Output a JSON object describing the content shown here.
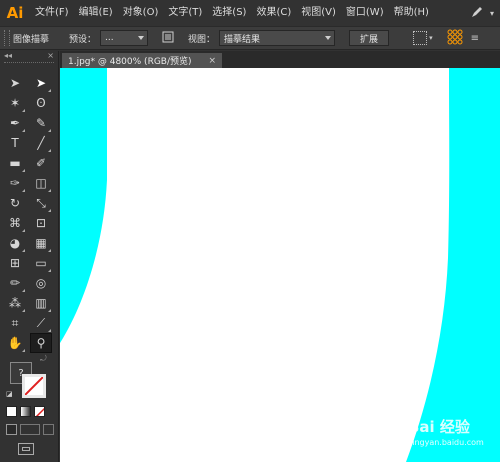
{
  "app": {
    "logo": "Ai"
  },
  "menu": {
    "items": [
      "文件(F)",
      "编辑(E)",
      "对象(O)",
      "文字(T)",
      "选择(S)",
      "效果(C)",
      "视图(V)",
      "窗口(W)",
      "帮助(H)"
    ]
  },
  "control_bar": {
    "title": "图像描摹",
    "preset_label": "预设：",
    "preset_value": "...",
    "view_label": "视图：",
    "view_value": "描摹结果",
    "expand_button": "扩展"
  },
  "tools_panel": {
    "collapse": "◂◂",
    "close": "×",
    "tools": [
      {
        "name": "selection-tool",
        "glyph": "➤"
      },
      {
        "name": "direct-selection-tool",
        "glyph": "➤"
      },
      {
        "name": "magic-wand-tool",
        "glyph": "✶"
      },
      {
        "name": "lasso-tool",
        "glyph": "ʘ"
      },
      {
        "name": "pen-tool",
        "glyph": "✒"
      },
      {
        "name": "curvature-tool",
        "glyph": "✎"
      },
      {
        "name": "type-tool",
        "glyph": "T"
      },
      {
        "name": "line-tool",
        "glyph": "╱"
      },
      {
        "name": "rectangle-tool",
        "glyph": "▬"
      },
      {
        "name": "paintbrush-tool",
        "glyph": "✐"
      },
      {
        "name": "blob-brush-tool",
        "glyph": "✑"
      },
      {
        "name": "eraser-tool",
        "glyph": "◫"
      },
      {
        "name": "rotate-tool",
        "glyph": "↻"
      },
      {
        "name": "scale-tool",
        "glyph": "⤡"
      },
      {
        "name": "width-tool",
        "glyph": "⌘"
      },
      {
        "name": "free-transform-tool",
        "glyph": "⊡"
      },
      {
        "name": "shape-builder-tool",
        "glyph": "◕"
      },
      {
        "name": "perspective-grid-tool",
        "glyph": "▦"
      },
      {
        "name": "mesh-tool",
        "glyph": "⊞"
      },
      {
        "name": "gradient-tool",
        "glyph": "▭"
      },
      {
        "name": "eyedropper-tool",
        "glyph": "✏"
      },
      {
        "name": "blend-tool",
        "glyph": "◎"
      },
      {
        "name": "symbol-sprayer-tool",
        "glyph": "⁂"
      },
      {
        "name": "column-graph-tool",
        "glyph": "▥"
      },
      {
        "name": "artboard-tool",
        "glyph": "⌗"
      },
      {
        "name": "slice-tool",
        "glyph": "⟋"
      },
      {
        "name": "hand-tool",
        "glyph": "✋"
      },
      {
        "name": "zoom-tool",
        "glyph": "⚲"
      }
    ],
    "help_glyph": "?"
  },
  "document": {
    "tab_title": "1.jpg* @ 4800% (RGB/预览)",
    "tab_close": "×",
    "cyan_color": "#00ffff"
  },
  "watermark": {
    "text": "Bai 经验",
    "url": "jingyan.baidu.com"
  }
}
